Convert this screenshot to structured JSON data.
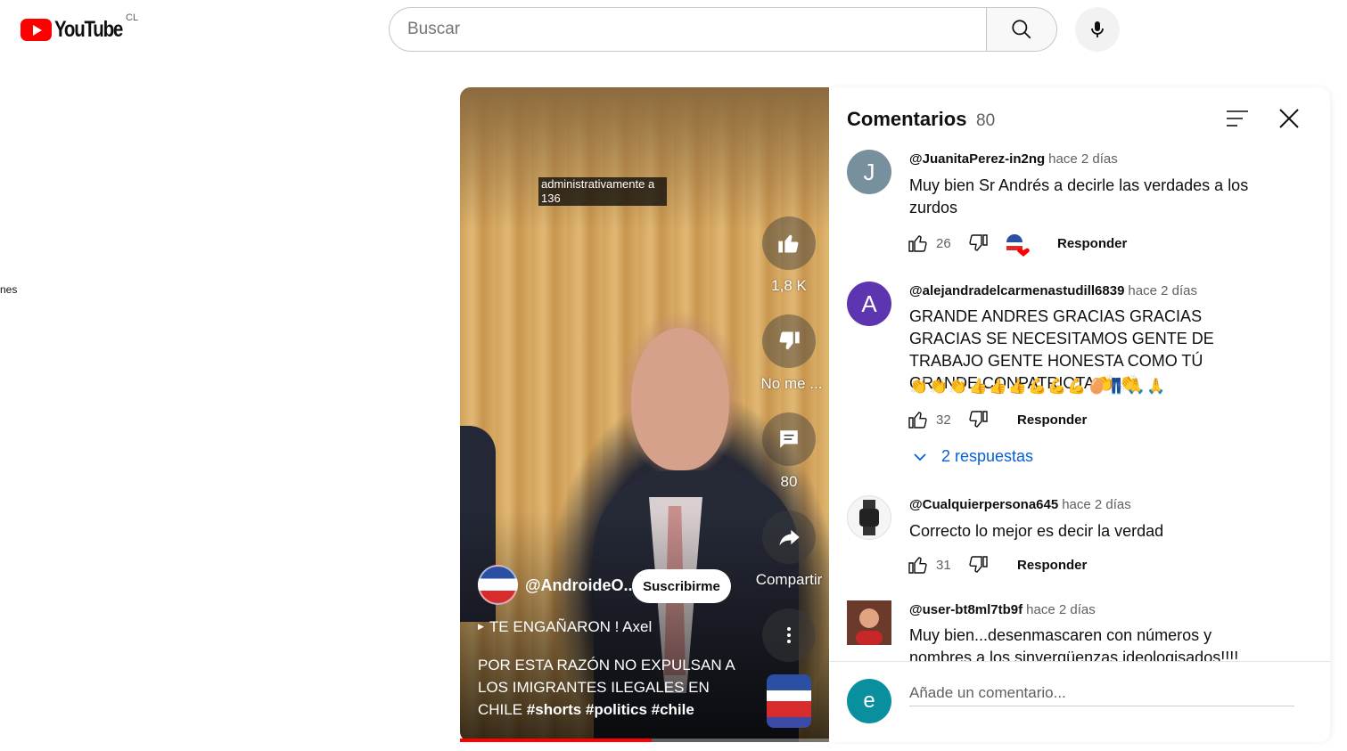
{
  "masthead": {
    "logo_text": "YouTube",
    "country_code": "CL",
    "search_placeholder": "Buscar"
  },
  "sidebar": {
    "partial_label": "nes"
  },
  "video": {
    "caption": "administrativamente a 136",
    "likes": "1,8 K",
    "dislike_label": "No me ...",
    "comments_count": "80",
    "share_label": "Compartir",
    "channel_name": "@AndroideO...",
    "subscribe_label": "Suscribirme",
    "playlist_label": "TE ENGAÑARON ! Axel",
    "title_text": "POR ESTA RAZÓN NO EXPULSAN A LOS IMIGRANTES ILEGALES EN CHILE ",
    "hashtags": "#shorts #politics #chile",
    "progress": 0.52
  },
  "comments_panel": {
    "title": "Comentarios",
    "count": "80",
    "reply_label": "Responder",
    "comments": [
      {
        "avatar_letter": "J",
        "avatar_color": "#78909c",
        "author": "@JuanitaPerez-in2ng",
        "time": "hace 2 días",
        "text": "Muy bien Sr Andrés a decirle las verdades a los zurdos",
        "likes": "26"
      },
      {
        "avatar_letter": "A",
        "avatar_color": "#5e35b1",
        "author": "@alejandradelcarmenastudill6839",
        "time": "hace 2 días",
        "text": "GRANDE ANDRES GRACIAS GRACIAS GRACIAS SE NECESITAMOS GENTE DE TRABAJO GENTE HONESTA COMO TÚ GRANDE CONPATRIOTA👏 👏",
        "emojis": "👏👏👏👍👍👍💪💪💪🥚👖🙏🙏",
        "likes": "32",
        "replies_label": "2 respuestas"
      },
      {
        "author": "@Cualquierpersona645",
        "time": "hace 2 días",
        "text": "Correcto lo mejor es decir la verdad",
        "likes": "31"
      },
      {
        "author": "@user-bt8ml7tb9f",
        "time": "hace 2 días",
        "text": "Muy bien...desenmascaren con números y nombres a los sinvergüenzas ideologisados!!!!"
      }
    ],
    "add_comment_placeholder": "Añade un comentario...",
    "my_avatar_letter": "e",
    "my_avatar_color": "#0a8f9e"
  }
}
